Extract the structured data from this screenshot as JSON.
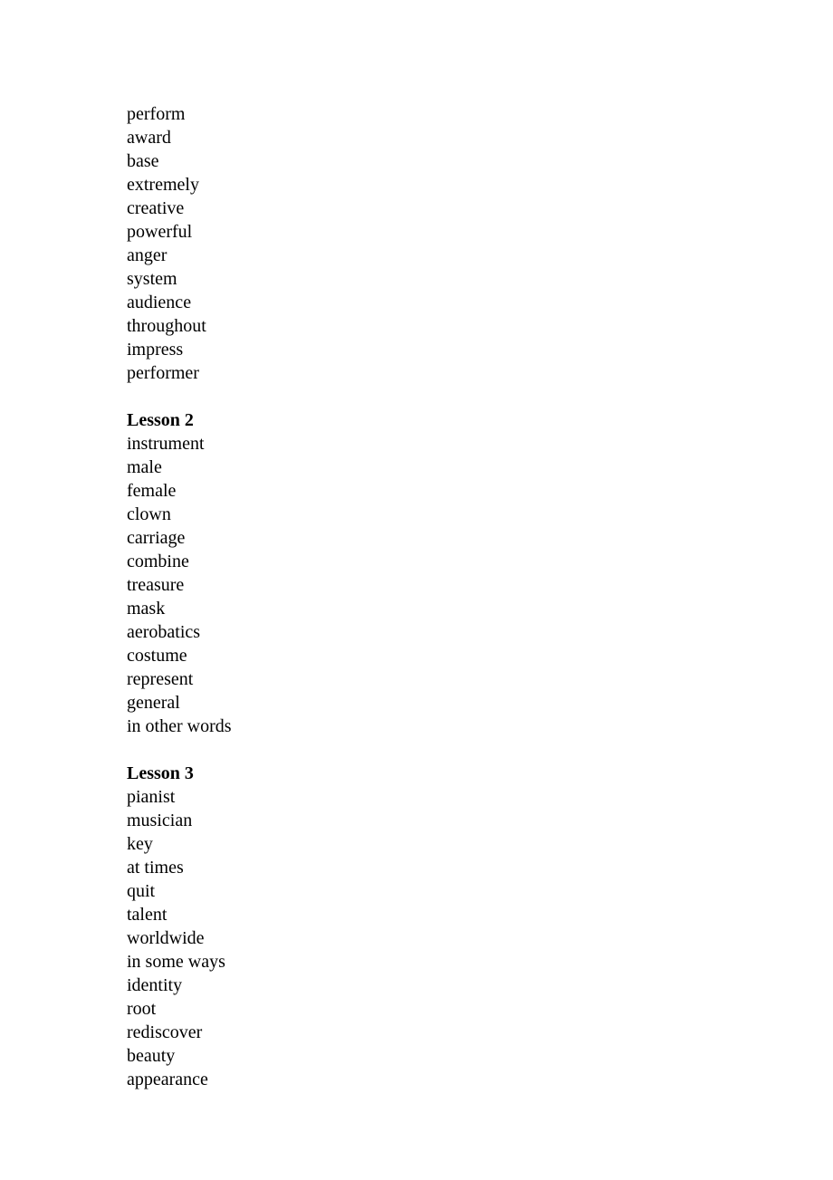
{
  "sections": [
    {
      "heading": "",
      "words": [
        "perform",
        "award",
        "base",
        "extremely",
        "creative",
        "powerful",
        "anger",
        "system",
        "audience",
        "throughout",
        "impress",
        "performer"
      ]
    },
    {
      "heading": "Lesson 2",
      "words": [
        "instrument",
        "male",
        "female",
        "clown",
        "carriage",
        "combine",
        "treasure",
        "mask",
        "aerobatics",
        "costume",
        "represent",
        "general",
        "in other words"
      ]
    },
    {
      "heading": "Lesson 3",
      "words": [
        "pianist",
        "musician",
        "key",
        "at times",
        "quit",
        "talent",
        "worldwide",
        "in some ways",
        "identity",
        "root",
        "rediscover",
        "beauty",
        "appearance"
      ]
    }
  ]
}
